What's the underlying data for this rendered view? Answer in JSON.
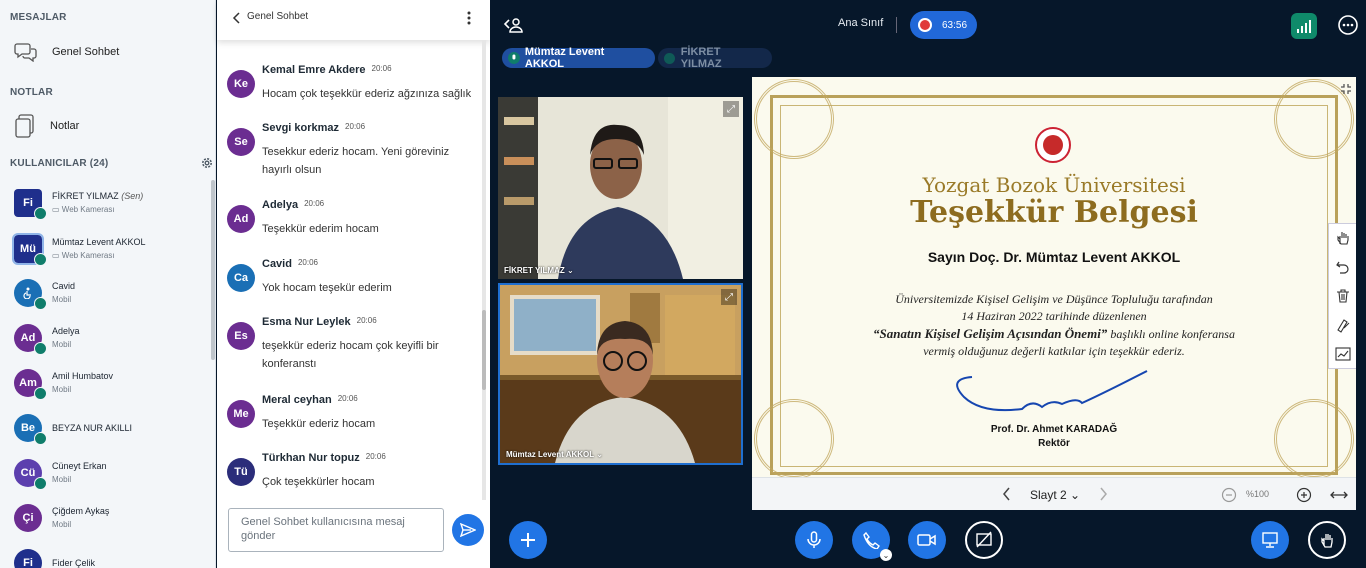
{
  "sidebar": {
    "messages_header": "MESAJLAR",
    "public_chat_label": "Genel Sohbet",
    "notes_header": "NOTLAR",
    "notes_label": "Notlar",
    "users_header": "KULLANICILAR (24)",
    "users": [
      {
        "initials": "Fi",
        "name": "FİKRET YILMAZ",
        "suffix": "(Sen)",
        "sub": "Web Kamerası",
        "color": "#1f2f8c"
      },
      {
        "initials": "Mü",
        "name": "Mümtaz Levent AKKOL",
        "suffix": "",
        "sub": "Web Kamerası",
        "color": "#1f2f8c"
      },
      {
        "initials": "",
        "name": "Cavid",
        "suffix": "",
        "sub": "Mobil",
        "color": "#1a6fb5"
      },
      {
        "initials": "Ad",
        "name": "Adelya",
        "suffix": "",
        "sub": "Mobil",
        "color": "#6b2d91"
      },
      {
        "initials": "Am",
        "name": "Amil Humbatov",
        "suffix": "",
        "sub": "Mobil",
        "color": "#6b2d91"
      },
      {
        "initials": "Be",
        "name": "BEYZA NUR AKILLI",
        "suffix": "",
        "sub": "",
        "color": "#1a6fb5"
      },
      {
        "initials": "Cü",
        "name": "Cüneyt Erkan",
        "suffix": "",
        "sub": "Mobil",
        "color": "#5c3fae"
      },
      {
        "initials": "Çi",
        "name": "Çiğdem Aykaş",
        "suffix": "",
        "sub": "Mobil",
        "color": "#6b2d91"
      },
      {
        "initials": "Fi",
        "name": "Fider Çelik",
        "suffix": "",
        "sub": "",
        "color": "#1f2f8c"
      }
    ]
  },
  "chat": {
    "title": "Genel Sohbet",
    "messages": [
      {
        "initials": "Ke",
        "name": "Kemal Emre Akdere",
        "time": "20:06",
        "text": "Hocam çok teşekkür ederiz ağzınıza sağlık",
        "color": "#6b2d91"
      },
      {
        "initials": "Se",
        "name": "Sevgi korkmaz",
        "time": "20:06",
        "text": "Tesekkur ederiz hocam. Yeni göreviniz hayırlı olsun",
        "color": "#6b2d91"
      },
      {
        "initials": "Ad",
        "name": "Adelya",
        "time": "20:06",
        "text": "Teşekkür ederim hocam",
        "color": "#6b2d91"
      },
      {
        "initials": "Ca",
        "name": "Cavid",
        "time": "20:06",
        "text": "Yok hocam teşekür ederim",
        "color": "#1a6fb5"
      },
      {
        "initials": "Es",
        "name": "Esma Nur Leylek",
        "time": "20:06",
        "text": "teşekkür ederiz hocam çok keyifli bir konferanstı",
        "color": "#6b2d91"
      },
      {
        "initials": "Me",
        "name": "Meral ceyhan",
        "time": "20:06",
        "text": "Teşekkür ederiz hocam",
        "color": "#6b2d91"
      },
      {
        "initials": "Tü",
        "name": "Türkhan Nur topuz",
        "time": "20:06",
        "text": "Çok teşekkürler hocam",
        "color": "#2b2d7a"
      }
    ],
    "input_placeholder": "Genel Sohbet kullanıcısına mesaj gönder"
  },
  "meeting": {
    "title": "Ana Sınıf",
    "recording_time": "63:56",
    "talkers": [
      "Mümtaz Levent AKKOL",
      "FİKRET YILMAZ"
    ],
    "videos": [
      {
        "label": "FİKRET YILMAZ ⌄"
      },
      {
        "label": "Mümtaz Levent AKKOL ⌄"
      }
    ]
  },
  "certificate": {
    "university": "Yozgat Bozok Üniversitesi",
    "title": "Teşekkür Belgesi",
    "recipient": "Sayın Doç. Dr. Mümtaz Levent AKKOL",
    "line1": "Üniversitemizde Kişisel Gelişim ve Düşünce Topluluğu tarafından",
    "line2": "14 Haziran 2022 tarihinde düzenlenen",
    "line3_bold": "“Sanatın Kişisel Gelişim Açısından Önemi”",
    "line3_rest": " başlıklı online konferansa",
    "line4": "vermiş olduğunuz değerli katkılar için teşekkür ederiz.",
    "signer": "Prof. Dr. Ahmet KARADAĞ",
    "signer_title": "Rektör"
  },
  "presentation": {
    "slide_label": "Slayt 2",
    "zoom": "%100"
  },
  "colors": {
    "accent": "#2175e5",
    "background": "#06172a",
    "connection": "#0f8a6a"
  }
}
